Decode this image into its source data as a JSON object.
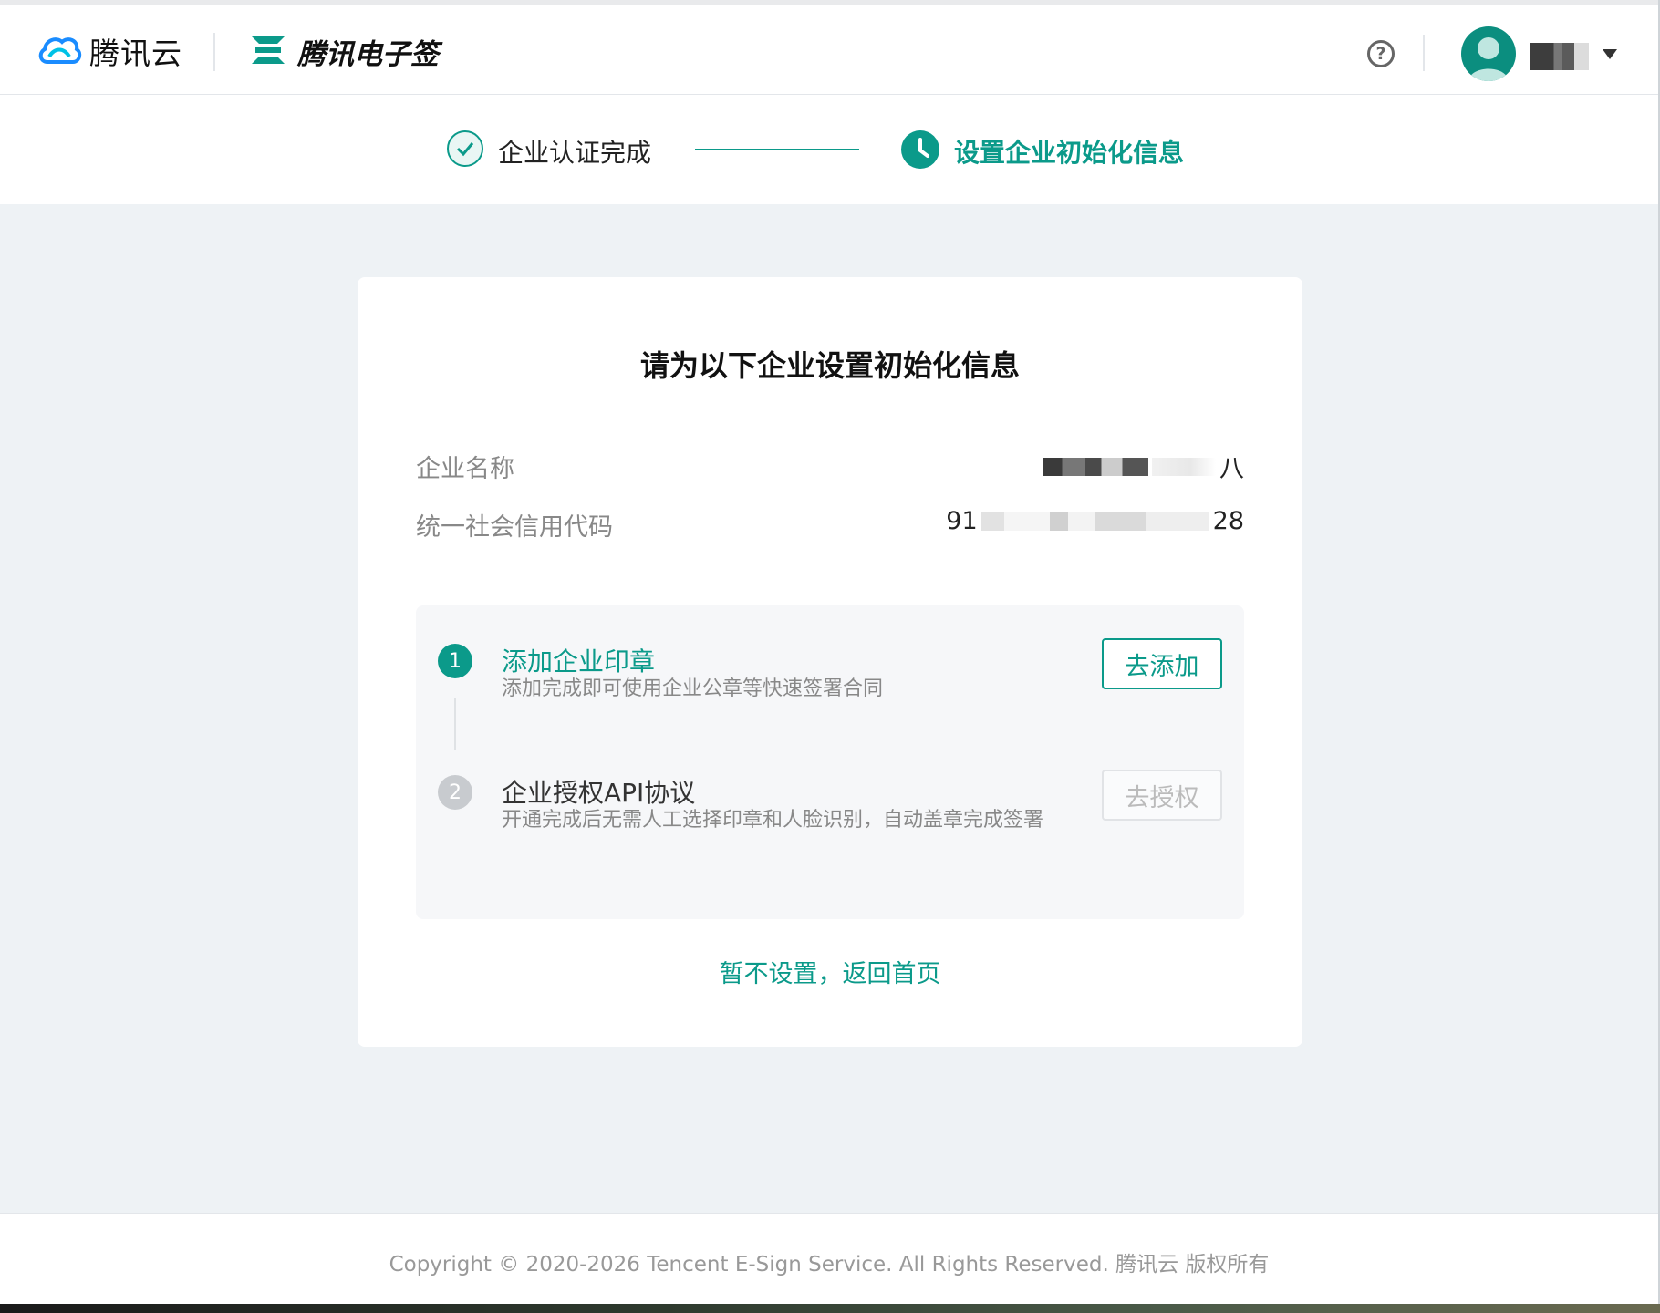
{
  "header": {
    "cloud_brand": "腾讯云",
    "product_brand": "腾讯电子签",
    "help_icon": "?",
    "icons": [
      "tencent-cloud-logo-icon",
      "esign-logo-icon",
      "help-icon",
      "avatar",
      "chevron-down-icon"
    ],
    "accent_color": "#0b9a8a"
  },
  "steps": {
    "step1": {
      "label": "企业认证完成",
      "status": "done"
    },
    "step2": {
      "label": "设置企业初始化信息",
      "status": "current"
    }
  },
  "card": {
    "title": "请为以下企业设置初始化信息",
    "company_name_label": "企业名称",
    "company_name_value_suffix": "八",
    "credit_code_label": "统一社会信用代码",
    "credit_code_prefix": "91",
    "credit_code_suffix": "28",
    "tasks": [
      {
        "number": "1",
        "title": "添加企业印章",
        "desc": "添加完成即可使用企业公章等快速签署合同",
        "button": "去添加",
        "enabled": true
      },
      {
        "number": "2",
        "title": "企业授权API协议",
        "desc": "开通完成后无需人工选择印章和人脸识别，自动盖章完成签署",
        "button": "去授权",
        "enabled": false
      }
    ],
    "skip_link": "暂不设置，返回首页"
  },
  "footer": {
    "copyright": "Copyright © 2020-2026 Tencent E-Sign Service. All Rights Reserved. 腾讯云 版权所有"
  }
}
